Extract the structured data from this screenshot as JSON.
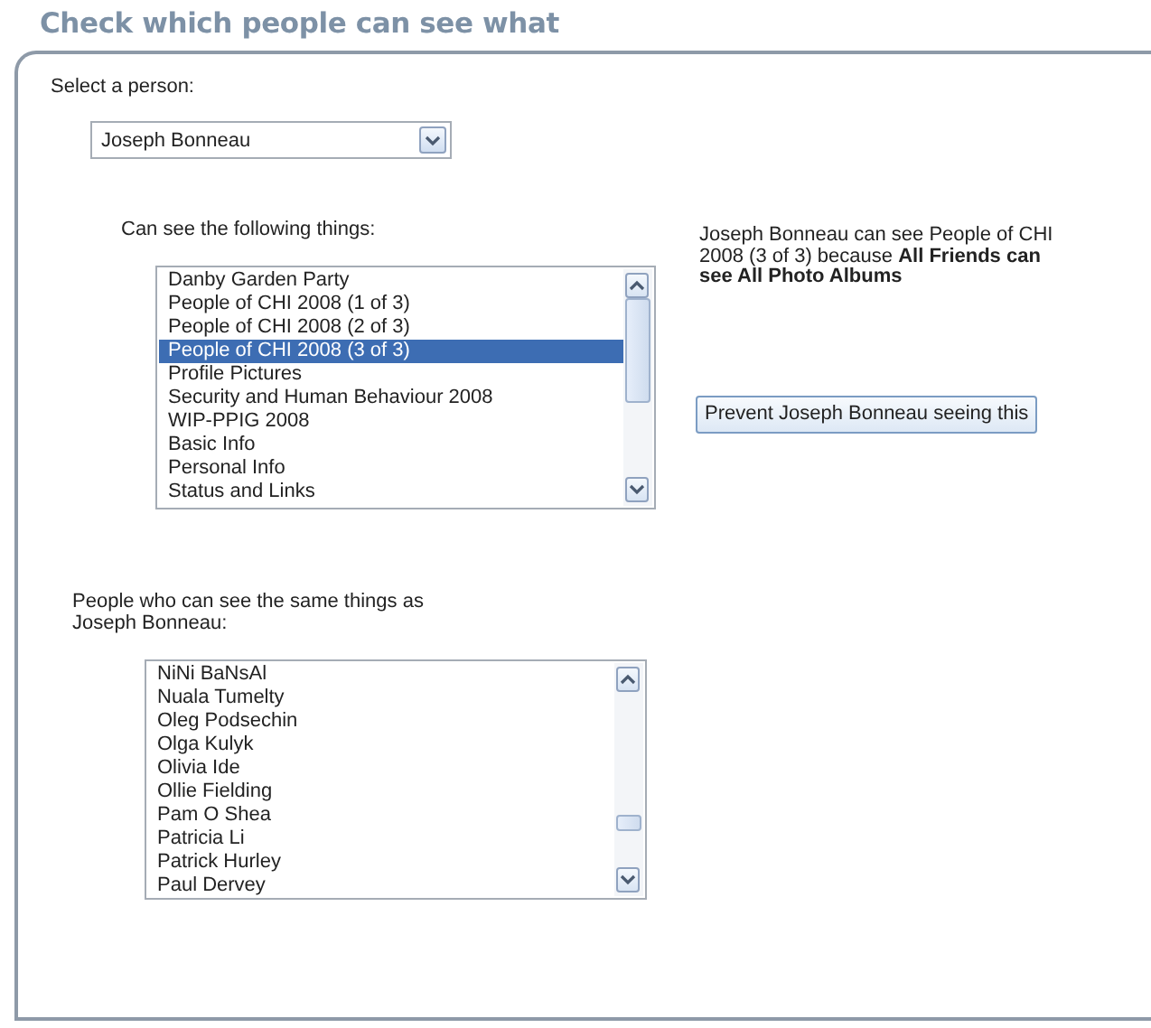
{
  "title": "Check which people can see what",
  "person_select": {
    "label": "Select a person:",
    "value": "Joseph Bonneau"
  },
  "things": {
    "label": "Can see the following things:",
    "items": [
      {
        "text": "Danby Garden Party",
        "selected": false
      },
      {
        "text": "People of CHI 2008 (1 of 3)",
        "selected": false
      },
      {
        "text": "People of CHI 2008 (2 of 3)",
        "selected": false
      },
      {
        "text": "People of CHI 2008 (3 of 3)",
        "selected": true
      },
      {
        "text": "Profile Pictures",
        "selected": false
      },
      {
        "text": "Security and Human Behaviour 2008",
        "selected": false
      },
      {
        "text": "WIP-PPIG 2008",
        "selected": false
      },
      {
        "text": "Basic Info",
        "selected": false
      },
      {
        "text": "Personal Info",
        "selected": false
      },
      {
        "text": "Status and Links",
        "selected": false
      }
    ]
  },
  "explanation": "Joseph Bonneau can see People of CHI 2008 (3 of 3) because **All Friends can see All Photo Albums**",
  "prevent_button": "Prevent Joseph Bonneau seeing this",
  "same_people": {
    "label": "People who can see the same things as Joseph Bonneau:",
    "items": [
      {
        "text": "NiNi BaNsAl",
        "selected": false
      },
      {
        "text": "Nuala Tumelty",
        "selected": false
      },
      {
        "text": "Oleg Podsechin",
        "selected": false
      },
      {
        "text": "Olga Kulyk",
        "selected": false
      },
      {
        "text": "Olivia Ide",
        "selected": false
      },
      {
        "text": "Ollie Fielding",
        "selected": false
      },
      {
        "text": "Pam O Shea",
        "selected": false
      },
      {
        "text": "Patricia Li",
        "selected": false
      },
      {
        "text": "Patrick Hurley",
        "selected": false
      },
      {
        "text": "Paul Dervey",
        "selected": false
      }
    ]
  }
}
